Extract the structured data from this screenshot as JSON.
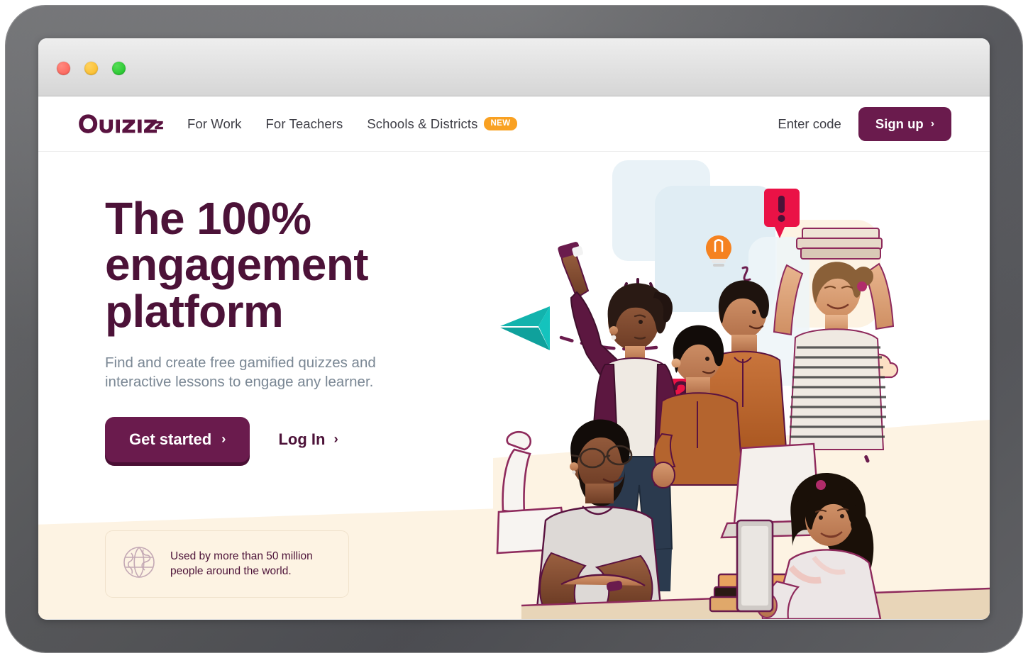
{
  "window": {
    "traffic_lights": [
      "close",
      "minimize",
      "maximize"
    ]
  },
  "navbar": {
    "logo_text": "Quizizz",
    "links": [
      {
        "label": "For Work",
        "badge": null
      },
      {
        "label": "For Teachers",
        "badge": null
      },
      {
        "label": "Schools & Districts",
        "badge": "NEW"
      }
    ],
    "enter_code_label": "Enter code",
    "signup_label": "Sign up",
    "signup_chevron": "›"
  },
  "hero": {
    "headline": "The 100% engagement platform",
    "subheadline": "Find and create free gamified quizzes and interactive lessons to engage any learner.",
    "primary_cta": {
      "label": "Get started",
      "chevron": "›"
    },
    "secondary_cta": {
      "label": "Log In",
      "chevron": "›"
    },
    "users_card": {
      "icon": "globe-icon",
      "line1": "Used by more than 50 million",
      "line2": "people around the world."
    }
  },
  "colors": {
    "brand_purple": "#6a1b4d",
    "headline_purple": "#4c1238",
    "badge_orange": "#f9a122",
    "subtext_gray": "#7a8794",
    "cream": "#fdf3e3",
    "teal_accent": "#12b3ad",
    "red_accent": "#ea1246",
    "bezel_gray": "#5f6063"
  },
  "illustration": {
    "description": "Photo collage of students and a teacher with laptops, books and tablets",
    "decorations": [
      {
        "name": "paper-plane",
        "color": "#12b3ad"
      },
      {
        "name": "lightbulb",
        "color": "#f58220"
      },
      {
        "name": "exclamation-bubble",
        "color": "#ea1246"
      },
      {
        "name": "question-bubble",
        "color": "#ea1246"
      },
      {
        "name": "thought-cloud",
        "color": "#fbe0c4"
      },
      {
        "name": "blue-rounded-square",
        "color": "#e4eff5"
      },
      {
        "name": "cream-rounded-square",
        "color": "#fdf3e3"
      },
      {
        "name": "dashed-trail",
        "color": "#6a1b4d"
      }
    ]
  }
}
